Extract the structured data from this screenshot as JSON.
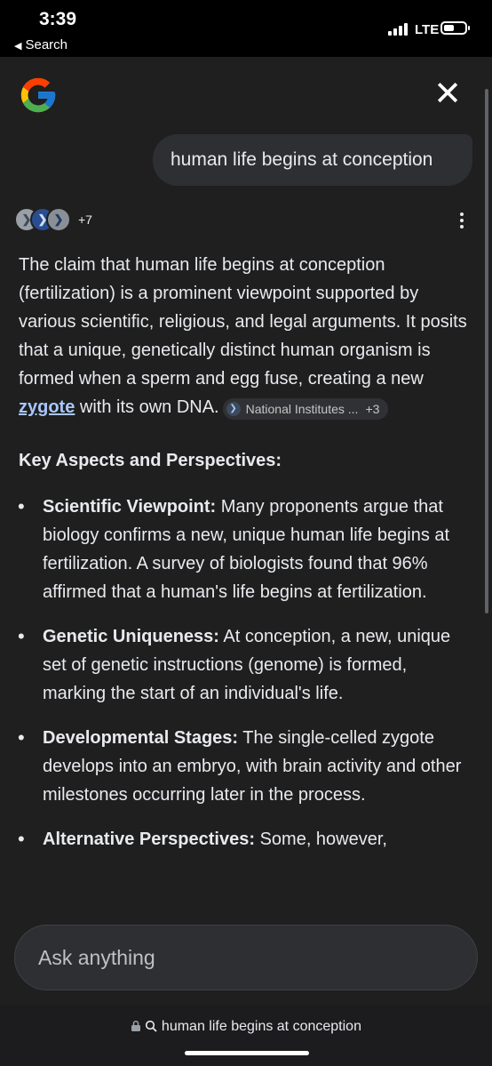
{
  "status_bar": {
    "time": "3:39",
    "back_label": "Search",
    "network": "LTE"
  },
  "header": {
    "logo": "google-g-logo",
    "close_icon": "✕"
  },
  "query": "human life begins at conception",
  "sources": {
    "more_count": "+7"
  },
  "answer": {
    "intro_text": "The claim that human life begins at conception (fertilization) is a prominent viewpoint supported by various scientific, religious, and legal arguments. It posits that a unique, genetically distinct human organism is formed when a sperm and egg fuse, creating a new ",
    "link_text": "zygote",
    "intro_tail": " with its own DNA.",
    "citation": {
      "label": "National Institutes ...",
      "more": "+3"
    },
    "section_heading": "Key Aspects and Perspectives:",
    "bullets": [
      {
        "title": "Scientific Viewpoint:",
        "text": " Many proponents argue that biology confirms a new, unique human life begins at fertilization. A survey of biologists found that 96% affirmed that a human's life begins at fertilization."
      },
      {
        "title": "Genetic Uniqueness:",
        "text": " At conception, a new, unique set of genetic instructions (genome) is formed, marking the start of an individual's life."
      },
      {
        "title": "Developmental Stages:",
        "text": " The single-celled zygote develops into an embryo, with brain activity and other milestones occurring later in the process."
      },
      {
        "title": "Alternative Perspectives:",
        "text": " Some, however,"
      }
    ]
  },
  "ask_input": {
    "placeholder": "Ask anything"
  },
  "url_bar": {
    "text": "human life begins at conception"
  },
  "colors": {
    "panel_bg": "#1f1f20",
    "link": "#a8c7fa",
    "bubble": "#2e2f33"
  }
}
